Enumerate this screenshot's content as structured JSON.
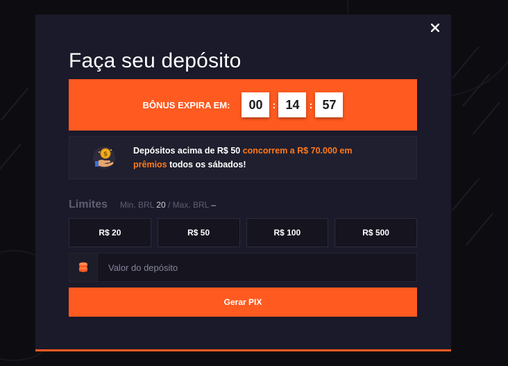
{
  "modal": {
    "title": "Faça seu depósito",
    "close_label": "×"
  },
  "timer": {
    "label": "BÔNUS EXPIRA EM:",
    "hours": "00",
    "minutes": "14",
    "seconds": "57",
    "separator": ":"
  },
  "promo": {
    "text_before": "Depósitos acima de R$ 50 ",
    "highlight": "concorrem a R$ 70.000 em prêmios",
    "text_after": " todos os sábados!",
    "icon": "coin-trophy-icon"
  },
  "limits": {
    "label": "Limites",
    "min_label": "Min. BRL",
    "min_value": "20",
    "separator": "/",
    "max_label": "Max. BRL",
    "max_value": "–"
  },
  "amount_options": [
    {
      "label": "R$ 20"
    },
    {
      "label": "R$ 50"
    },
    {
      "label": "R$ 100"
    },
    {
      "label": "R$ 500"
    }
  ],
  "deposit_input": {
    "placeholder": "Valor do depósito",
    "value": "",
    "icon": "coins-icon"
  },
  "submit": {
    "label": "Gerar PIX"
  },
  "colors": {
    "accent": "#ff5a20",
    "highlight": "#ff7a1a",
    "modal_bg": "#1b1a2a"
  }
}
